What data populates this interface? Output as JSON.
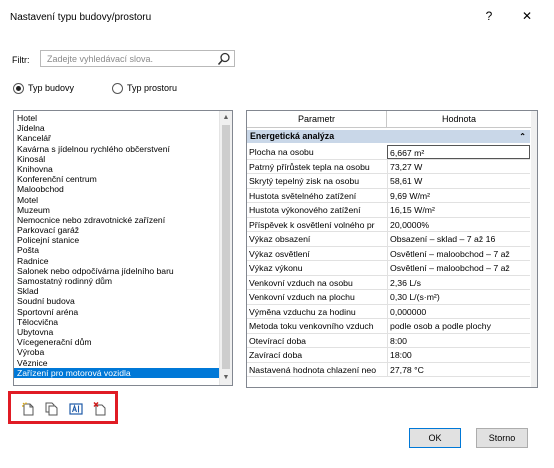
{
  "window": {
    "title": "Nastavení typu budovy/prostoru",
    "help": "?",
    "close": "✕"
  },
  "filter": {
    "label": "Filtr:",
    "placeholder": "Zadejte vyhledávací slova."
  },
  "radios": [
    {
      "label": "Typ budovy",
      "selected": true
    },
    {
      "label": "Typ prostoru",
      "selected": false
    }
  ],
  "types": [
    "Hotel",
    "Jídelna",
    "Kancelář",
    "Kavárna s jídelnou rychlého občerstvení",
    "Kinosál",
    "Knihovna",
    "Konferenční centrum",
    "Maloobchod",
    "Motel",
    "Muzeum",
    "Nemocnice nebo zdravotnické zařízení",
    "Parkovací garáž",
    "Policejní stanice",
    "Pošta",
    "Radnice",
    "Salonek nebo odpočívárna jídelního baru",
    "Samostatný rodinný dům",
    "Sklad",
    "Soudní budova",
    "Sportovní aréna",
    "Tělocvična",
    "Ubytovna",
    "Vícegenerační dům",
    "Výroba",
    "Věznice",
    "Zařízení pro motorová vozidla"
  ],
  "selected_type_index": 25,
  "params": {
    "header": {
      "param": "Parametr",
      "value": "Hodnota"
    },
    "group": "Energetická analýza",
    "rows": [
      {
        "name": "Plocha na osobu",
        "value": "6,667 m²"
      },
      {
        "name": "Patrný přírůstek tepla na osobu",
        "value": "73,27 W"
      },
      {
        "name": "Skrytý tepelný zisk na osobu",
        "value": "58,61 W"
      },
      {
        "name": "Hustota světelného zatížení",
        "value": "9,69 W/m²"
      },
      {
        "name": "Hustota výkonového zatížení",
        "value": "16,15 W/m²"
      },
      {
        "name": "Příspěvek k osvětlení volného pr",
        "value": "20,0000%"
      },
      {
        "name": "Výkaz obsazení",
        "value": "Obsazení – sklad – 7 až 16"
      },
      {
        "name": "Výkaz osvětlení",
        "value": "Osvětlení – maloobchod – 7 až"
      },
      {
        "name": "Výkaz výkonu",
        "value": "Osvětlení – maloobchod – 7 až"
      },
      {
        "name": "Venkovní vzduch na osobu",
        "value": "2,36 L/s"
      },
      {
        "name": "Venkovní vzduch na plochu",
        "value": "0,30 L/(s·m²)"
      },
      {
        "name": "Výměna vzduchu za hodinu",
        "value": "0,000000"
      },
      {
        "name": "Metoda toku venkovního vzduch",
        "value": "podle osob a podle plochy"
      },
      {
        "name": "Otevírací doba",
        "value": "8:00"
      },
      {
        "name": "Zavírací doba",
        "value": "18:00"
      },
      {
        "name": "Nastavená hodnota chlazení neo",
        "value": "27,78 °C"
      }
    ]
  },
  "tools": [
    "new-type-icon",
    "duplicate-icon",
    "rename-icon",
    "delete-icon"
  ],
  "buttons": {
    "ok": "OK",
    "cancel": "Storno"
  }
}
